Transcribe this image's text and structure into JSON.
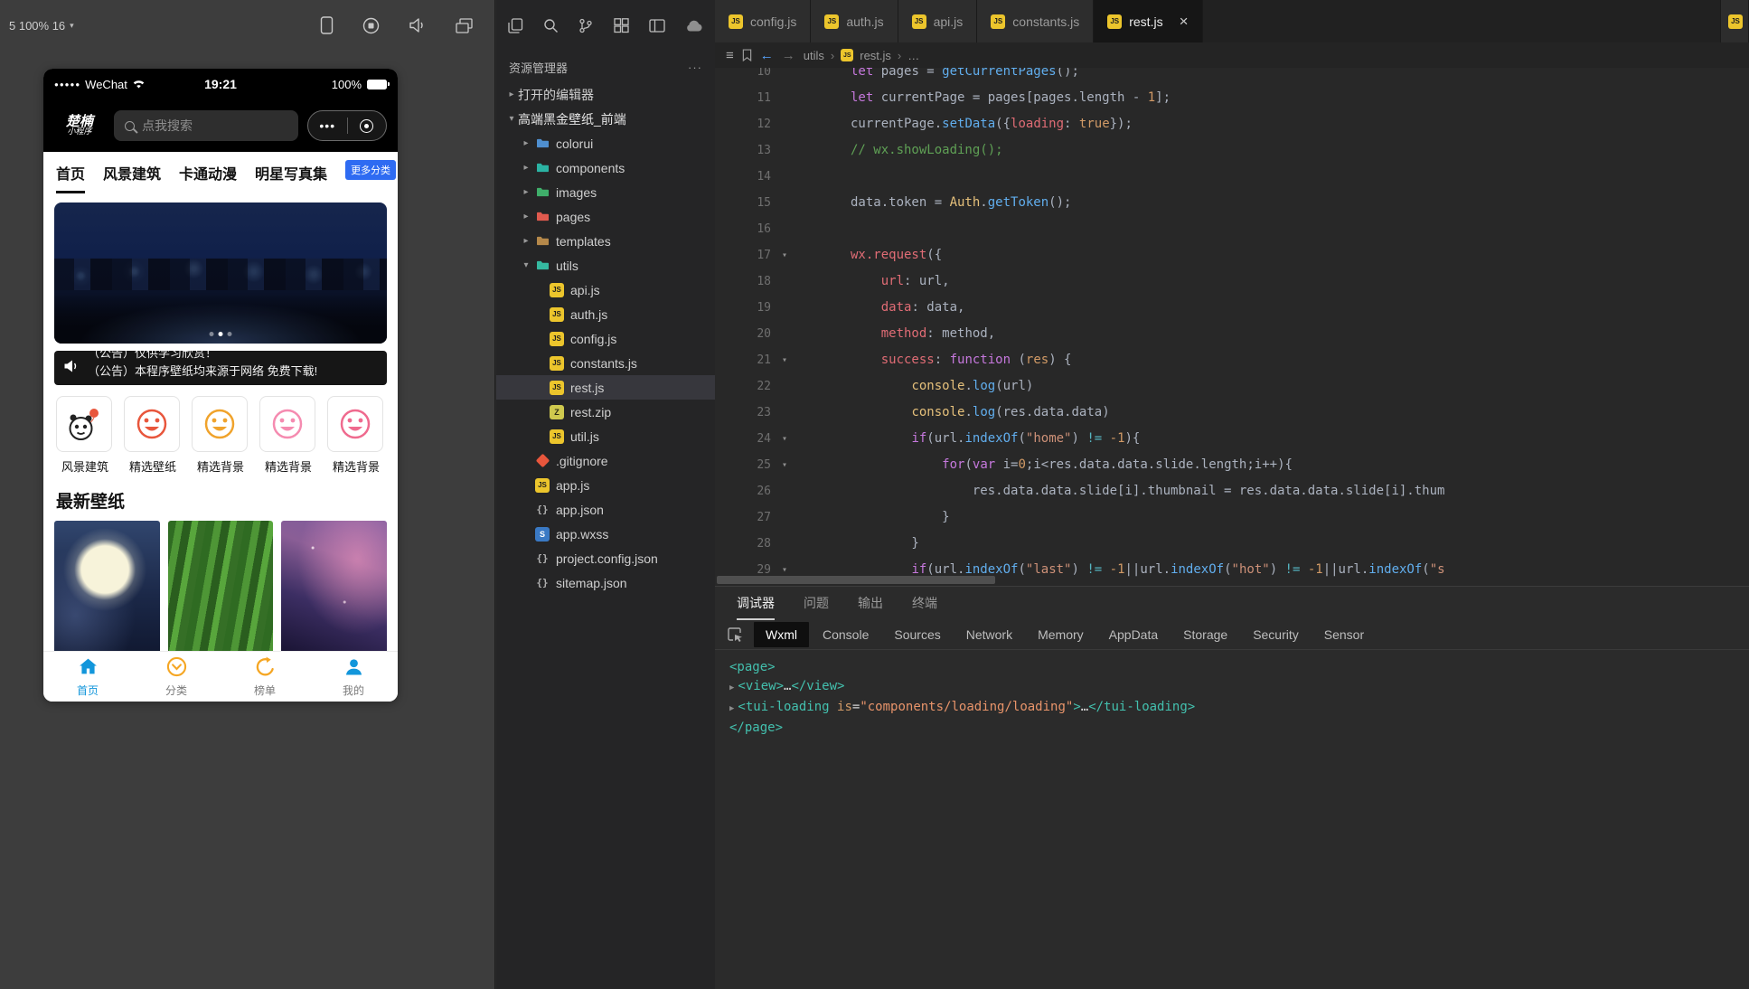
{
  "simulator": {
    "toolbar": {
      "zoom": "5 100% 16",
      "icons": [
        "device-icon",
        "record-icon",
        "mute-icon",
        "windows-icon"
      ]
    },
    "phone": {
      "statusbar": {
        "signal": "●●●●●",
        "carrier": "WeChat",
        "time": "19:21",
        "battery": "100%"
      },
      "header": {
        "logo_line1": "楚楠",
        "logo_line2": "小程序",
        "search_placeholder": "点我搜索",
        "capsule_dots": "•••"
      },
      "nav_tabs": [
        {
          "label": "首页",
          "active": true
        },
        {
          "label": "风景建筑",
          "active": false
        },
        {
          "label": "卡通动漫",
          "active": false
        },
        {
          "label": "明星写真集",
          "active": false
        }
      ],
      "more_badge": "更多分类",
      "notice": {
        "line1": "（公告）仅供学习欣赏！",
        "line2": "（公告）本程序壁纸均来源于网络 免费下载!"
      },
      "categories": [
        {
          "label": "风景建筑",
          "icon": "panda-icon",
          "color": "#222222"
        },
        {
          "label": "精选壁纸",
          "icon": "smiley-icon",
          "color": "#e8563c"
        },
        {
          "label": "精选背景",
          "icon": "smiley-icon",
          "color": "#f0a32c"
        },
        {
          "label": "精选背景",
          "icon": "smiley-icon",
          "color": "#f58bb0"
        },
        {
          "label": "精选背景",
          "icon": "smiley-icon",
          "color": "#ef6a8e"
        }
      ],
      "section_title": "最新壁纸",
      "wallpapers": [
        {
          "name": "moon"
        },
        {
          "name": "grass"
        },
        {
          "name": "aurora"
        }
      ],
      "tabbar": [
        {
          "label": "首页",
          "icon": "home-icon",
          "active": true
        },
        {
          "label": "分类",
          "icon": "category-icon",
          "active": false
        },
        {
          "label": "榜单",
          "icon": "ranking-icon",
          "active": false
        },
        {
          "label": "我的",
          "icon": "profile-icon",
          "active": false
        }
      ]
    }
  },
  "explorer": {
    "toolbar_icons": [
      "files-icon",
      "search-icon",
      "git-branch-icon",
      "extensions-icon",
      "layout-icon",
      "cloud-icon"
    ],
    "title": "资源管理器",
    "more": "···",
    "open_editors_label": "打开的编辑器",
    "root_label": "高端黑金壁纸_前端",
    "items": [
      {
        "label": "colorui",
        "kind": "folder",
        "color": "#4f8fd0",
        "chevron": "right",
        "indent": 1
      },
      {
        "label": "components",
        "kind": "folder",
        "color": "#2bb3a3",
        "chevron": "right",
        "indent": 1
      },
      {
        "label": "images",
        "kind": "folder",
        "color": "#3fae6a",
        "chevron": "right",
        "indent": 1
      },
      {
        "label": "pages",
        "kind": "folder",
        "color": "#e05a4e",
        "chevron": "right",
        "indent": 1
      },
      {
        "label": "templates",
        "kind": "folder",
        "color": "#b5884a",
        "chevron": "right",
        "indent": 1
      },
      {
        "label": "utils",
        "kind": "folder",
        "color": "#35b9a0",
        "chevron": "down",
        "indent": 1
      },
      {
        "label": "api.js",
        "kind": "js",
        "indent": 2
      },
      {
        "label": "auth.js",
        "kind": "js",
        "indent": 2
      },
      {
        "label": "config.js",
        "kind": "js",
        "indent": 2
      },
      {
        "label": "constants.js",
        "kind": "js",
        "indent": 2
      },
      {
        "label": "rest.js",
        "kind": "js",
        "indent": 2,
        "selected": true
      },
      {
        "label": "rest.zip",
        "kind": "zip",
        "indent": 2
      },
      {
        "label": "util.js",
        "kind": "js",
        "indent": 2
      },
      {
        "label": ".gitignore",
        "kind": "git",
        "indent": 1
      },
      {
        "label": "app.js",
        "kind": "js",
        "indent": 1
      },
      {
        "label": "app.json",
        "kind": "json",
        "indent": 1
      },
      {
        "label": "app.wxss",
        "kind": "wxss",
        "indent": 1
      },
      {
        "label": "project.config.json",
        "kind": "json",
        "indent": 1
      },
      {
        "label": "sitemap.json",
        "kind": "json",
        "indent": 1
      }
    ]
  },
  "editor": {
    "tabs": [
      {
        "label": "config.js"
      },
      {
        "label": "auth.js"
      },
      {
        "label": "api.js"
      },
      {
        "label": "constants.js"
      },
      {
        "label": "rest.js",
        "active": true,
        "close": true
      },
      {
        "label": "",
        "partial": true
      }
    ],
    "breadcrumb": [
      "utils",
      "rest.js",
      "…"
    ],
    "code": {
      "lines": [
        {
          "n": 10,
          "tokens": [
            [
              "kw",
              "let"
            ],
            [
              "pl",
              " pages = "
            ],
            [
              "fn",
              "getCurrentPages"
            ],
            [
              "pl",
              "();"
            ]
          ]
        },
        {
          "n": 11,
          "tokens": [
            [
              "kw",
              "let"
            ],
            [
              "pl",
              " currentPage = pages[pages.length - "
            ],
            [
              "num",
              "1"
            ],
            [
              "pl",
              "];"
            ]
          ]
        },
        {
          "n": 12,
          "tokens": [
            [
              "pl",
              "currentPage."
            ],
            [
              "fn",
              "setData"
            ],
            [
              "pl",
              "({"
            ],
            [
              "prop",
              "loading"
            ],
            [
              "pl",
              ": "
            ],
            [
              "num",
              "true"
            ],
            [
              "pl",
              "});"
            ]
          ]
        },
        {
          "n": 13,
          "tokens": [
            [
              "cmt",
              "// wx.showLoading();"
            ]
          ]
        },
        {
          "n": 14,
          "tokens": []
        },
        {
          "n": 15,
          "tokens": [
            [
              "pl",
              "data.token = "
            ],
            [
              "cls",
              "Auth"
            ],
            [
              "pl",
              "."
            ],
            [
              "fn",
              "getToken"
            ],
            [
              "pl",
              "();"
            ]
          ]
        },
        {
          "n": 16,
          "tokens": []
        },
        {
          "n": 17,
          "fold": true,
          "tokens": [
            [
              "wx",
              "wx.request"
            ],
            [
              "pl",
              "({"
            ]
          ]
        },
        {
          "n": 18,
          "tokens": [
            [
              "pl",
              "    "
            ],
            [
              "prop",
              "url"
            ],
            [
              "pl",
              ": url,"
            ]
          ]
        },
        {
          "n": 19,
          "tokens": [
            [
              "pl",
              "    "
            ],
            [
              "prop",
              "data"
            ],
            [
              "pl",
              ": data,"
            ]
          ]
        },
        {
          "n": 20,
          "tokens": [
            [
              "pl",
              "    "
            ],
            [
              "prop",
              "method"
            ],
            [
              "pl",
              ": method,"
            ]
          ]
        },
        {
          "n": 21,
          "fold": true,
          "tokens": [
            [
              "pl",
              "    "
            ],
            [
              "prop",
              "success"
            ],
            [
              "pl",
              ": "
            ],
            [
              "kw",
              "function"
            ],
            [
              "pl",
              " ("
            ],
            [
              "param",
              "res"
            ],
            [
              "pl",
              ") {"
            ]
          ]
        },
        {
          "n": 22,
          "tokens": [
            [
              "pl",
              "        "
            ],
            [
              "cls",
              "console"
            ],
            [
              "pl",
              "."
            ],
            [
              "fn",
              "log"
            ],
            [
              "pl",
              "(url)"
            ]
          ]
        },
        {
          "n": 23,
          "tokens": [
            [
              "pl",
              "        "
            ],
            [
              "cls",
              "console"
            ],
            [
              "pl",
              "."
            ],
            [
              "fn",
              "log"
            ],
            [
              "pl",
              "(res.data.data)"
            ]
          ]
        },
        {
          "n": 24,
          "fold": true,
          "tokens": [
            [
              "pl",
              "        "
            ],
            [
              "kw",
              "if"
            ],
            [
              "pl",
              "(url."
            ],
            [
              "fn",
              "indexOf"
            ],
            [
              "pl",
              "("
            ],
            [
              "str",
              "\"home\""
            ],
            [
              "pl",
              ") "
            ],
            [
              "op",
              "!="
            ],
            [
              "pl",
              " "
            ],
            [
              "num",
              "-1"
            ],
            [
              "pl",
              "){"
            ]
          ]
        },
        {
          "n": 25,
          "fold": true,
          "tokens": [
            [
              "pl",
              "            "
            ],
            [
              "kw",
              "for"
            ],
            [
              "pl",
              "("
            ],
            [
              "kw",
              "var"
            ],
            [
              "pl",
              " i="
            ],
            [
              "num",
              "0"
            ],
            [
              "pl",
              ";i<res.data.data.slide.length;i++){"
            ]
          ]
        },
        {
          "n": 26,
          "tokens": [
            [
              "pl",
              "                res.data.data.slide[i].thumbnail = res.data.data.slide[i].thum"
            ]
          ]
        },
        {
          "n": 27,
          "tokens": [
            [
              "pl",
              "            }"
            ]
          ]
        },
        {
          "n": 28,
          "tokens": [
            [
              "pl",
              "        }"
            ]
          ]
        },
        {
          "n": 29,
          "fold": true,
          "tokens": [
            [
              "pl",
              "        "
            ],
            [
              "kw",
              "if"
            ],
            [
              "pl",
              "(url."
            ],
            [
              "fn",
              "indexOf"
            ],
            [
              "pl",
              "("
            ],
            [
              "str",
              "\"last\""
            ],
            [
              "pl",
              ") "
            ],
            [
              "op",
              "!="
            ],
            [
              "pl",
              " "
            ],
            [
              "num",
              "-1"
            ],
            [
              "pl",
              "||url."
            ],
            [
              "fn",
              "indexOf"
            ],
            [
              "pl",
              "("
            ],
            [
              "str",
              "\"hot\""
            ],
            [
              "pl",
              ") "
            ],
            [
              "op",
              "!="
            ],
            [
              "pl",
              " "
            ],
            [
              "num",
              "-1"
            ],
            [
              "pl",
              "||url."
            ],
            [
              "fn",
              "indexOf"
            ],
            [
              "pl",
              "("
            ],
            [
              "str",
              "\"s"
            ]
          ]
        }
      ]
    }
  },
  "devtools": {
    "panel_tabs": [
      {
        "label": "调试器",
        "active": true
      },
      {
        "label": "问题",
        "active": false
      },
      {
        "label": "输出",
        "active": false
      },
      {
        "label": "终端",
        "active": false
      }
    ],
    "inspector_tabs": [
      {
        "label": "Wxml",
        "active": true
      },
      {
        "label": "Console",
        "active": false
      },
      {
        "label": "Sources",
        "active": false
      },
      {
        "label": "Network",
        "active": false
      },
      {
        "label": "Memory",
        "active": false
      },
      {
        "label": "AppData",
        "active": false
      },
      {
        "label": "Storage",
        "active": false
      },
      {
        "label": "Security",
        "active": false
      },
      {
        "label": "Sensor",
        "active": false
      }
    ],
    "wxml_lines": [
      {
        "arrow": false,
        "tokens": [
          [
            "tag",
            "<page>"
          ]
        ]
      },
      {
        "arrow": true,
        "tokens": [
          [
            "tag",
            "<view>"
          ],
          [
            "pl",
            "…"
          ],
          [
            "tag",
            "</view>"
          ]
        ]
      },
      {
        "arrow": true,
        "tokens": [
          [
            "tag",
            "<tui-loading"
          ],
          [
            "pl",
            " "
          ],
          [
            "attr",
            "is"
          ],
          [
            "op",
            "="
          ],
          [
            "str",
            "\"components/loading/loading\""
          ],
          [
            "tag",
            ">"
          ],
          [
            "pl",
            "…"
          ],
          [
            "tag",
            "</tui-loading>"
          ]
        ]
      },
      {
        "arrow": false,
        "tokens": [
          [
            "tag",
            "</page>"
          ]
        ]
      }
    ]
  }
}
